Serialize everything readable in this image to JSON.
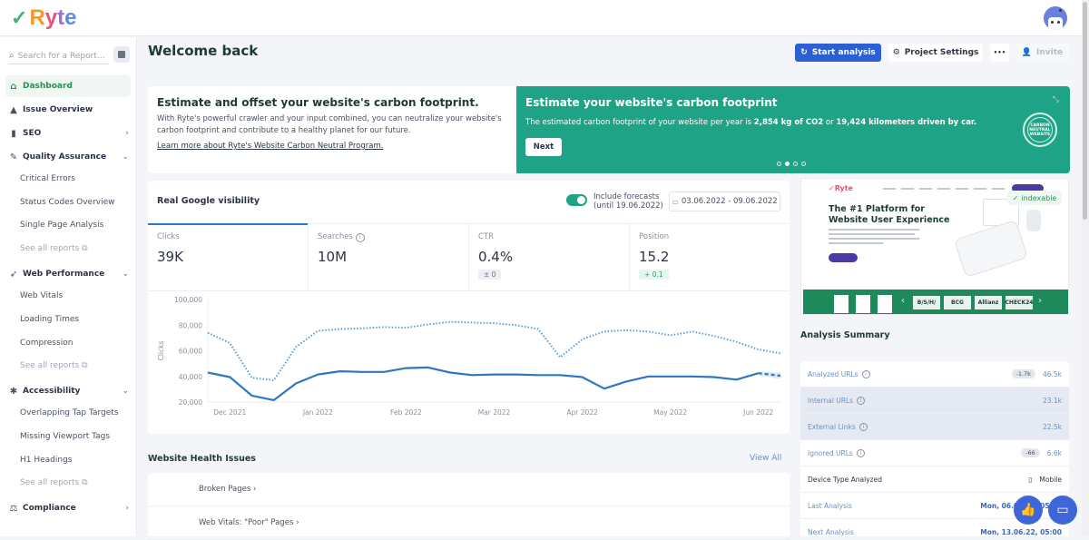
{
  "app": {
    "logo_check": "✓",
    "logo_letters": [
      "R",
      "y",
      "t",
      "e"
    ]
  },
  "sidebar": {
    "search_placeholder": "Search for a Report...",
    "items": [
      {
        "label": "Dashboard",
        "icon": "home-icon",
        "active": true
      },
      {
        "label": "Issue Overview",
        "icon": "warning-icon"
      },
      {
        "label": "SEO",
        "icon": "bar-chart-icon",
        "chevron": "›"
      },
      {
        "label": "Quality Assurance",
        "icon": "wrench-icon",
        "chevron": "⌄",
        "children": [
          "Critical Errors",
          "Status Codes Overview",
          "Single Page Analysis"
        ],
        "see_all": "See all reports"
      },
      {
        "label": "Web Performance",
        "icon": "rocket-icon",
        "chevron": "⌄",
        "children": [
          "Web Vitals",
          "Loading Times",
          "Compression"
        ],
        "see_all": "See all reports"
      },
      {
        "label": "Accessibility",
        "icon": "person-icon",
        "chevron": "⌄",
        "children": [
          "Overlapping Tap Targets",
          "Missing Viewport Tags",
          "H1 Headings"
        ],
        "see_all": "See all reports"
      },
      {
        "label": "Compliance",
        "icon": "scale-icon",
        "chevron": "›"
      }
    ]
  },
  "header": {
    "title": "Welcome back",
    "start_analysis": "Start analysis",
    "project_settings": "Project Settings",
    "more": "•••",
    "invite": "Invite"
  },
  "carbon": {
    "left_title": "Estimate and offset your website's carbon footprint.",
    "left_text": "With Ryte's powerful crawler and your input combined, you can neutralize your website's carbon footprint and contribute to a healthy planet for our future.",
    "left_link": "Learn more about Ryte's Website Carbon Neutral Program.",
    "right_title": "Estimate your website's carbon footprint",
    "right_text_pre": "The estimated carbon footprint of your website per year is ",
    "right_co2": "2,854 kg of CO2",
    "right_text_mid": " or ",
    "right_km": "19,424 kilometers driven by car.",
    "next": "Next",
    "badge_text": "CARBON NEUTRAL WEBSITE",
    "slides": 4,
    "active_slide": 1
  },
  "visibility": {
    "title": "Real Google visibility",
    "forecast_label_1": "Include forecasts",
    "forecast_label_2": "(until 19.06.2022)",
    "forecast_on": true,
    "date_range": "03.06.2022 - 09.06.2022",
    "kpis": [
      {
        "label": "Clicks",
        "value": "39K",
        "active": true
      },
      {
        "label": "Searches",
        "value": "10M",
        "info": true
      },
      {
        "label": "CTR",
        "value": "0.4%",
        "change": "± 0",
        "change_type": "neutral"
      },
      {
        "label": "Position",
        "value": "15.2",
        "change": "+ 0.1",
        "change_type": "pos"
      }
    ]
  },
  "chart_data": {
    "type": "line",
    "ylabel": "Clicks",
    "ylim": [
      20000,
      100000
    ],
    "yticks": [
      "100,000",
      "80,000",
      "60,000",
      "40,000",
      "20,000"
    ],
    "ytick_values": [
      100000,
      80000,
      60000,
      40000,
      20000
    ],
    "xlabels": [
      "Dec 2021",
      "Jan 2022",
      "Feb 2022",
      "Mar 2022",
      "Apr 2022",
      "May 2022",
      "Jun 2022"
    ],
    "xlabel_positions": [
      1,
      5,
      9,
      13,
      17,
      21,
      25
    ],
    "xmax": 26,
    "series": [
      {
        "name": "Searches (scaled)",
        "style": "dotted",
        "x": [
          0,
          1,
          2,
          3,
          4,
          5,
          6,
          7,
          8,
          9,
          10,
          11,
          12,
          13,
          14,
          15,
          16,
          17,
          18,
          19,
          20,
          21,
          22,
          23,
          24,
          25,
          26
        ],
        "values": [
          74000,
          66000,
          39000,
          37000,
          63000,
          75500,
          77000,
          77500,
          78500,
          78000,
          80500,
          82500,
          82000,
          81500,
          80000,
          77000,
          55000,
          69000,
          75000,
          76000,
          75000,
          72000,
          75000,
          71500,
          67000,
          61000,
          58000
        ]
      },
      {
        "name": "Clicks",
        "style": "solid",
        "x": [
          0,
          1,
          2,
          3,
          4,
          5,
          6,
          7,
          8,
          9,
          10,
          11,
          12,
          13,
          14,
          15,
          16,
          17,
          18,
          19,
          20,
          21,
          22,
          23,
          24,
          25
        ],
        "values": [
          43000,
          39500,
          25000,
          21500,
          34500,
          41500,
          44000,
          43500,
          43500,
          46500,
          47000,
          43000,
          41000,
          41500,
          41500,
          41000,
          41000,
          39500,
          30500,
          36000,
          40000,
          40000,
          40000,
          39500,
          37500,
          42500
        ]
      },
      {
        "name": "Clicks forecast",
        "style": "dashed",
        "x": [
          25,
          26
        ],
        "values": [
          42500,
          40500
        ]
      }
    ]
  },
  "health": {
    "title": "Website Health Issues",
    "view_all": "View All",
    "rows": [
      "Broken Pages ›",
      "Web Vitals: \"Poor\" Pages ›"
    ]
  },
  "preview": {
    "logo": "✓Ryte",
    "headline_1": "The #1 Platform for",
    "headline_2": "Website User Experience",
    "indexable": "indexable",
    "brands": [
      "B/S/H/",
      "BCG",
      "Allianz",
      "CHECK24"
    ]
  },
  "summary": {
    "title": "Analysis Summary",
    "rows": [
      {
        "label": "Analyzed URLs",
        "info": true,
        "delta": "-1.7k",
        "value": "46.5k"
      },
      {
        "label": "Internal URLs",
        "info": true,
        "value": "23.1k",
        "shaded": true
      },
      {
        "label": "External Links",
        "info": true,
        "value": "22.5k",
        "shaded": true
      },
      {
        "label": "Ignored URLs",
        "info": true,
        "delta": "-66",
        "value": "6.6k"
      },
      {
        "label": "Device Type Analyzed",
        "value": "Mobile",
        "dark": true,
        "device_icon": "▯"
      },
      {
        "label": "Last Analysis",
        "value": "Mon, 06.06.22, 05:00",
        "bold": true
      },
      {
        "label": "Next Analysis",
        "value": "Mon, 13.06.22, 05:00",
        "bold": true
      }
    ]
  },
  "colors": {
    "brand_green": "#1ea386",
    "primary_blue": "#2d5fd4",
    "line_blue": "#2e77c2",
    "dotted_blue": "#5aa0d8"
  }
}
